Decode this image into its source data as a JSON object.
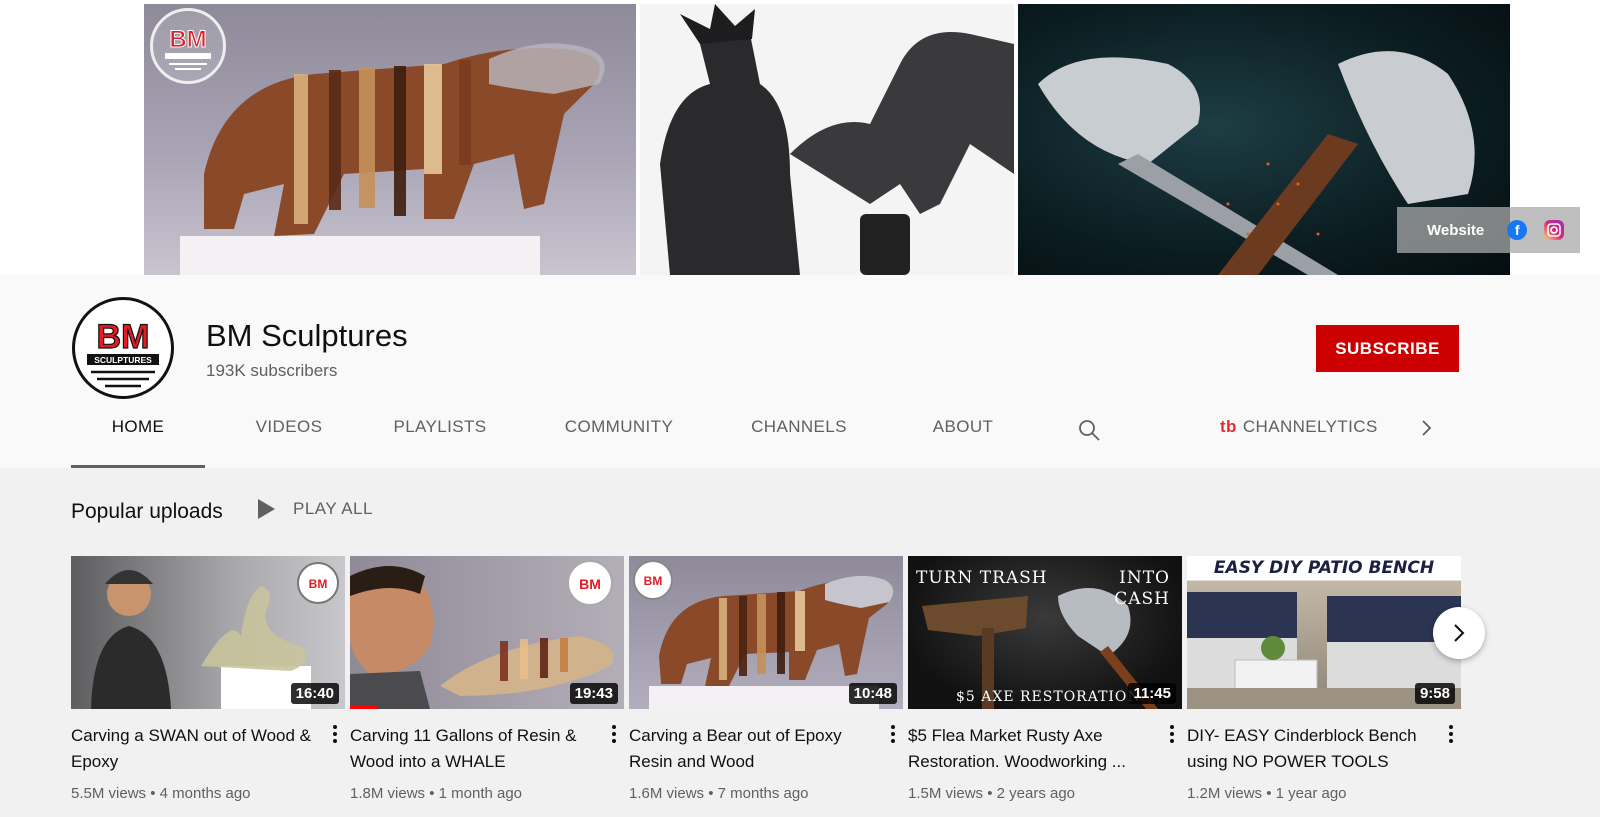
{
  "banner": {
    "links": {
      "website_label": "Website",
      "facebook_icon": "facebook-icon",
      "instagram_icon": "instagram-icon"
    }
  },
  "channel": {
    "logo_text": "BM",
    "logo_sub": "SCULPTURES",
    "name": "BM Sculptures",
    "subscribers": "193K subscribers",
    "subscribe_label": "SUBSCRIBE"
  },
  "tabs": [
    {
      "label": "HOME",
      "active": true
    },
    {
      "label": "VIDEOS"
    },
    {
      "label": "PLAYLISTS"
    },
    {
      "label": "COMMUNITY"
    },
    {
      "label": "CHANNELS"
    },
    {
      "label": "ABOUT"
    }
  ],
  "extension": {
    "logo": "tb",
    "label": "CHANNELYTICS"
  },
  "section": {
    "title": "Popular uploads",
    "play_all": "PLAY ALL"
  },
  "videos": [
    {
      "title": "Carving a SWAN out of Wood & Epoxy",
      "duration": "16:40",
      "views": "5.5M views",
      "age": "4 months ago"
    },
    {
      "title": "Carving 11 Gallons of Resin & Wood into a WHALE",
      "duration": "19:43",
      "views": "1.8M views",
      "age": "1 month ago",
      "watched_fraction": 0.1
    },
    {
      "title": "Carving a Bear out of Epoxy Resin and Wood",
      "duration": "10:48",
      "views": "1.6M views",
      "age": "7 months ago"
    },
    {
      "title": "$5 Flea Market Rusty Axe Restoration. Woodworking ...",
      "duration": "11:45",
      "views": "1.5M views",
      "age": "2 years ago",
      "thumb_text_top_left": "TURN TRASH",
      "thumb_text_top_right": "INTO CASH",
      "thumb_text_bottom": "$5 AXE RESTORATION"
    },
    {
      "title": "DIY- EASY Cinderblock Bench using NO POWER TOOLS",
      "duration": "9:58",
      "views": "1.2M views",
      "age": "1 year ago",
      "thumb_text_top": "EASY DIY PATIO BENCH"
    }
  ],
  "colors": {
    "subscribe": "#cc0000",
    "meta_text": "#606060",
    "background": "#f1f1f1"
  }
}
